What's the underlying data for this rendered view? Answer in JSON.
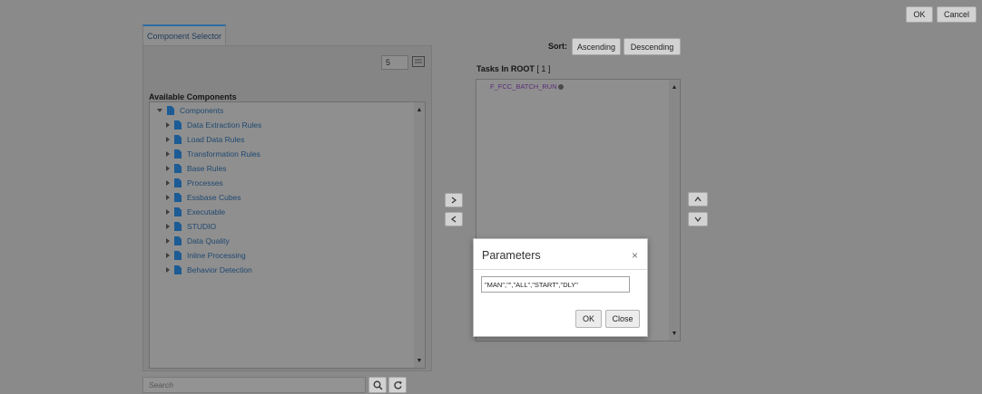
{
  "header": {
    "ok_label": "OK",
    "cancel_label": "Cancel"
  },
  "component_selector": {
    "tab_label": "Component Selector",
    "page_size": "5",
    "available_title": "Available Components",
    "tree": {
      "root": "Components",
      "children": [
        "Data Extraction Rules",
        "Load Data Rules",
        "Transformation Rules",
        "Base Rules",
        "Processes",
        "Essbase Cubes",
        "Executable",
        "STUDIO",
        "Data Quality",
        "Inline Processing",
        "Behavior Detection"
      ]
    },
    "search_placeholder": "Search"
  },
  "sort": {
    "label": "Sort:",
    "ascending_label": "Ascending",
    "descending_label": "Descending"
  },
  "tasks": {
    "title": "Tasks In ROOT",
    "count": "[ 1 ]",
    "items": [
      "F_FCC_BATCH_RUN"
    ]
  },
  "dialog": {
    "title": "Parameters",
    "close_symbol": "×",
    "input_value": "\"MAN\",\"\",\"ALL\",\"START\",\"DLY\"",
    "ok_label": "OK",
    "close_label": "Close"
  },
  "icons": {
    "move_right": "chevron-right-icon",
    "move_left": "chevron-left-icon",
    "move_up": "chevron-up-icon",
    "move_down": "chevron-down-icon"
  }
}
